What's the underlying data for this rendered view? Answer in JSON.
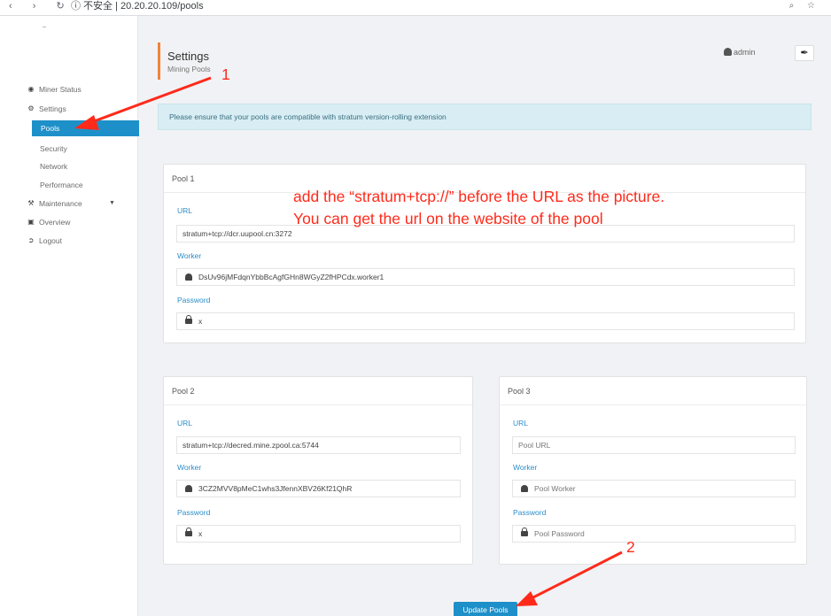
{
  "browser": {
    "nav_icons": "‹ › ↻",
    "address": "ⓘ 不安全 | 20.20.20.109/pools",
    "right_icons": "⌕ ☆"
  },
  "sidebar": {
    "items": [
      {
        "label": "Miner Status",
        "icon": "dashboard-icon"
      },
      {
        "label": "Settings",
        "icon": "gears-icon"
      },
      {
        "label": "Maintenance",
        "icon": "wrench-icon"
      },
      {
        "label": "Overview",
        "icon": "chip-icon"
      },
      {
        "label": "Logout",
        "icon": "logout-icon"
      }
    ],
    "settings_sub": [
      "Pools",
      "Security",
      "Network",
      "Performance"
    ],
    "active_item": "Pools"
  },
  "header": {
    "title": "Settings",
    "subtitle": "Mining Pools",
    "user": "admin"
  },
  "alert": "Please ensure that your pools are compatible with stratum version-rolling extension",
  "pools": [
    {
      "title": "Pool 1",
      "url_label": "URL",
      "url": "stratum+tcp://dcr.uupool.cn:3272",
      "worker_label": "Worker",
      "worker": "DsUv96jMFdqnYbbBcAgfGHn8WGyZ2fHPCdx.worker1",
      "password_label": "Password",
      "password": "x"
    },
    {
      "title": "Pool 2",
      "url_label": "URL",
      "url": "stratum+tcp://decred.mine.zpool.ca:5744",
      "worker_label": "Worker",
      "worker": "3CZ2MVV8pMeC1whs3JfennXBV26Kf21QhR",
      "password_label": "Password",
      "password": "x"
    },
    {
      "title": "Pool 3",
      "url_label": "URL",
      "url_placeholder": "Pool URL",
      "worker_label": "Worker",
      "worker_placeholder": "Pool Worker",
      "password_label": "Password",
      "password_placeholder": "Pool Password"
    }
  ],
  "update_button": "Update Pools",
  "annotations": {
    "marker1": "1",
    "marker2": "2",
    "note_line1": "add the  “stratum+tcp://” before the URL as the picture.",
    "note_line2": "You can get the url on the website of the pool",
    "color": "#ff2a1a"
  },
  "colors": {
    "accent": "#1e90c9",
    "header_bar": "#f0833a",
    "alert_bg": "#d8eef4",
    "label_blue": "#2d8dc8"
  }
}
